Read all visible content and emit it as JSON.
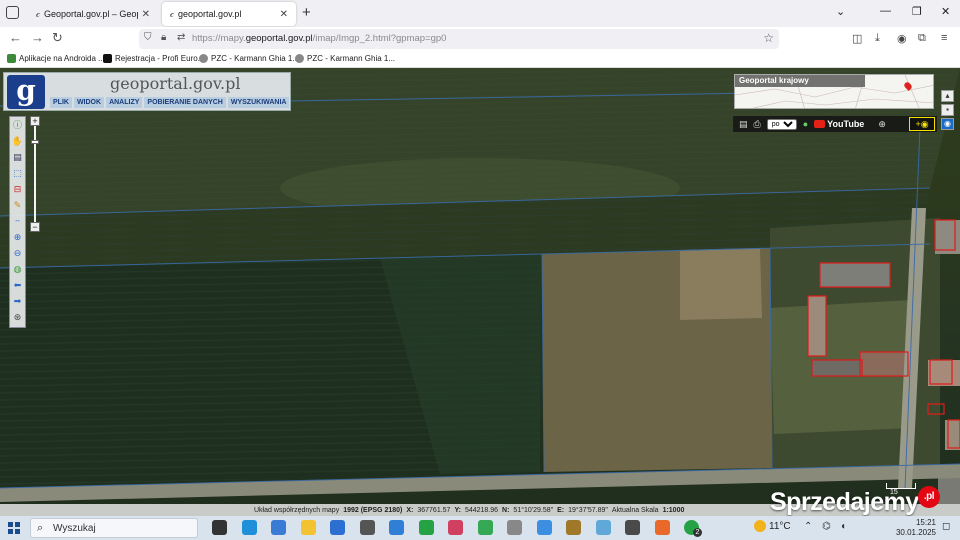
{
  "browser": {
    "tabs": [
      {
        "title": "Geoportal.gov.pl – Geoportal krajowy",
        "active": false
      },
      {
        "title": "geoportal.gov.pl",
        "active": true
      }
    ],
    "url_prefix": "https://mapy.",
    "url_host": "geoportal.gov.pl",
    "url_path": "/imap/Imgp_2.html?gpmap=gp0",
    "bookmarks": [
      {
        "label": "Aplikacje na Androida ...",
        "color": "#3d8a3a"
      },
      {
        "label": "Rejestracja - Profi Euro...",
        "color": "#111111"
      },
      {
        "label": "PZC - Karmann Ghia 1...",
        "color": "#888888"
      },
      {
        "label": "PZC - Karmann Ghia 1...",
        "color": "#888888"
      }
    ]
  },
  "geoportal": {
    "logo_letter": "g",
    "logo_text": "geoportal.gov.pl",
    "menu": [
      "PLIK",
      "WIDOK",
      "ANALIZY",
      "POBIERANIE DANYCH",
      "WYSZUKIWANIA"
    ],
    "overview_title": "Geoportal krajowy",
    "language": "pol",
    "youtube": "YouTube"
  },
  "status": {
    "system_label": "Układ współrzędnych mapy",
    "system_value": "1992 (EPSG 2180)",
    "x_label": "X:",
    "x_value": "367761.57",
    "y_label": "Y:",
    "y_value": "544218.96",
    "n_label": "N:",
    "n_value": "51°10'29.58\"",
    "e_label": "E:",
    "e_value": "19°37'57.89\"",
    "scale_label": "Aktualna Skala",
    "scale_value": "1:1000",
    "scalebar_label": "15"
  },
  "watermark": {
    "text": "Sprzedajemy",
    "suffix": ".pl"
  },
  "taskbar": {
    "search_placeholder": "Wyszukaj",
    "temperature": "11°C",
    "time": "15:21",
    "date": "30.01.2025",
    "apps": [
      {
        "name": "task-view-icon",
        "color": "#333333"
      },
      {
        "name": "edge-icon",
        "color": "#1f8fd8"
      },
      {
        "name": "store-icon",
        "color": "#3a7bd5"
      },
      {
        "name": "explorer-icon",
        "color": "#f2c230"
      },
      {
        "name": "mail-icon",
        "color": "#2d6fd0"
      },
      {
        "name": "app-icon",
        "color": "#555555"
      },
      {
        "name": "paint-icon",
        "color": "#2f7fd6"
      },
      {
        "name": "whatsapp-icon",
        "color": "#25a244"
      },
      {
        "name": "gallery-icon",
        "color": "#d04060"
      },
      {
        "name": "play-icon",
        "color": "#34a853"
      },
      {
        "name": "photos-icon",
        "color": "#888888"
      },
      {
        "name": "onedrive-icon",
        "color": "#3c8ee0"
      },
      {
        "name": "game-icon",
        "color": "#a0782a"
      },
      {
        "name": "files-icon",
        "color": "#5fa8d8"
      },
      {
        "name": "camera-icon",
        "color": "#4a4a4a"
      },
      {
        "name": "firefox-icon",
        "color": "#e8692a"
      },
      {
        "name": "whatsapp-badge-icon",
        "color": "#25a244"
      }
    ],
    "badge": "2"
  }
}
